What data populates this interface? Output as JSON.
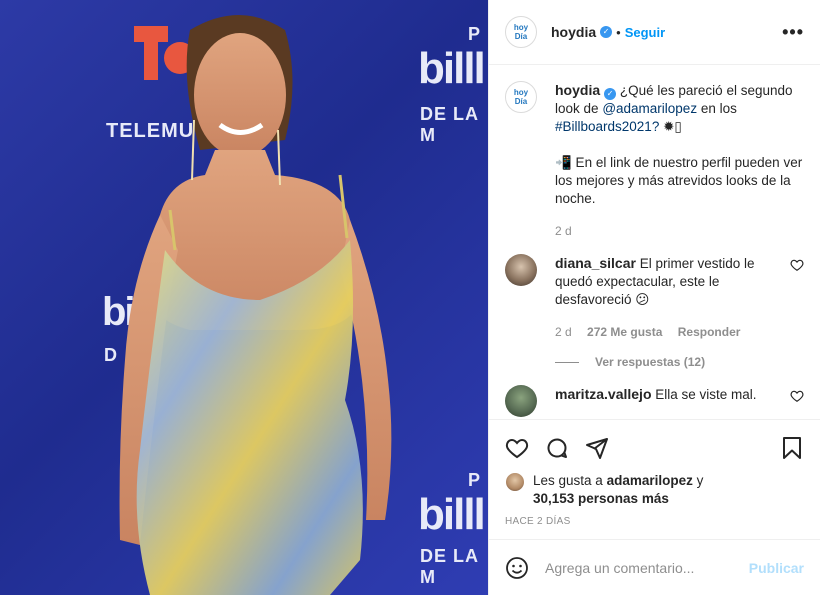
{
  "photo": {
    "wall_texts": [
      "TELEMU",
      "P",
      "billl",
      "DE LA M",
      "bi",
      "D",
      "P",
      "billl",
      "DE LA M"
    ],
    "colors": {
      "background": "#2233a0",
      "dress_yellow": "#e6d86a",
      "dress_blue": "#8fb1d6"
    }
  },
  "header": {
    "username": "hoydia",
    "separator": "•",
    "follow_label": "Seguir",
    "more_label": "•••",
    "avatar_text_top": "hoy",
    "avatar_text_bottom": "Día"
  },
  "caption": {
    "username": "hoydia",
    "text_1": "¿Qué les pareció el segundo look de",
    "mention": "@adamarilopez",
    "text_2": "en los",
    "hashtag": "#Billboards2021?",
    "emoji_1": "✹▯",
    "text_3": "📲 En el link de nuestro perfil pueden ver los mejores y más atrevidos looks de la noche.",
    "time": "2 d"
  },
  "comments": [
    {
      "username": "diana_silcar",
      "text": "El primer vestido le quedó expectacular, este le desfavoreció 😕",
      "time": "2 d",
      "likes": "272 Me gusta",
      "reply_label": "Responder",
      "view_replies": "Ver respuestas (12)"
    },
    {
      "username": "maritza.vallejo",
      "text": "Ella se viste mal."
    }
  ],
  "likes": {
    "prefix": "Les gusta a",
    "user": "adamarilopez",
    "suffix": "y",
    "count": "30,153 personas más"
  },
  "time_ago": "HACE 2 DÍAS",
  "add_comment": {
    "placeholder": "Agrega un comentario...",
    "publish_label": "Publicar"
  }
}
